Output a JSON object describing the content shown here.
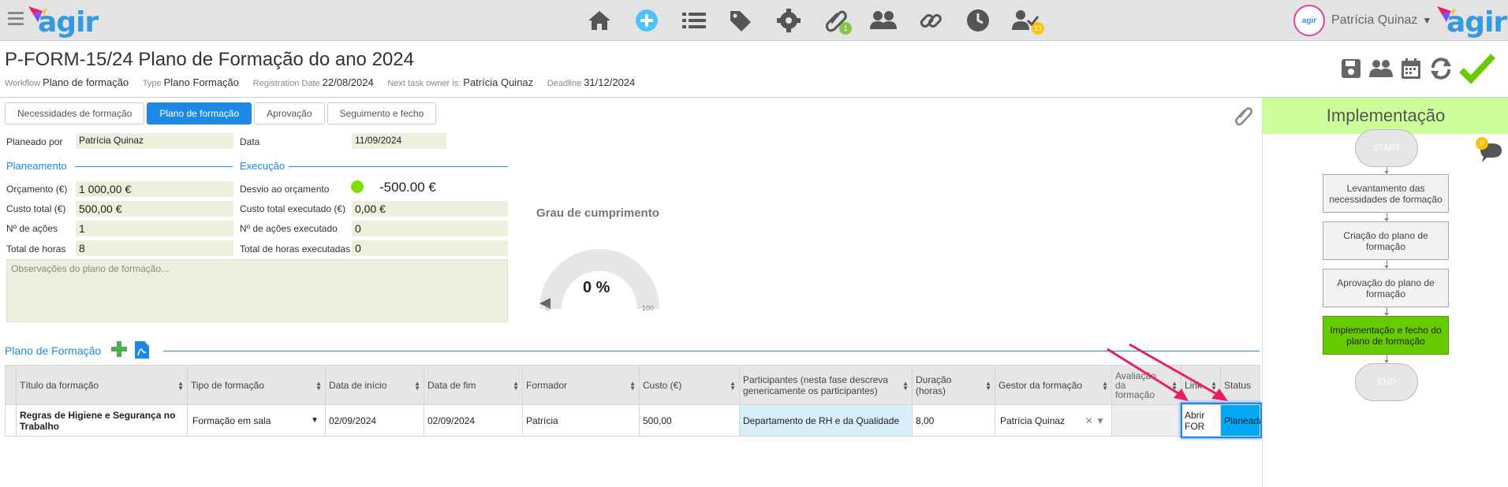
{
  "colors": {
    "accent": "#1e88e5",
    "highlight_bg": "#eeeedd",
    "phase_bg": "#ccff99",
    "active_step": "#66cc00",
    "status_blue": "#03a9f4",
    "arrow": "#e91e63"
  },
  "topbar": {
    "brand": "agir",
    "nav_icons": [
      "home-icon",
      "add-icon",
      "list-icon",
      "tag-icon",
      "gear-icon",
      "attachment-icon",
      "users-icon",
      "link-icon",
      "clock-icon",
      "user-check-icon"
    ],
    "attachment_badge": "1",
    "tasks_badge": "13",
    "user_name": "Patrícia Quinaz"
  },
  "header": {
    "title": "P-FORM-15/24 Plano de Formação do ano 2024",
    "workflow_label": "Workflow",
    "workflow_value": "Plano de formação",
    "type_label": "Type",
    "type_value": "Plano Formação",
    "reg_label": "Registration Date",
    "reg_value": "22/08/2024",
    "owner_label": "Next task owner is:",
    "owner_value": "Patrícia Quinaz",
    "deadline_label": "Deadline",
    "deadline_value": "31/12/2024"
  },
  "tabs": [
    "Necessidades de formação",
    "Plano de formação",
    "Aprovação",
    "Seguimento e fecho"
  ],
  "form": {
    "planeado_label": "Planeado por",
    "planeado_value": "Patrícia Quinaz",
    "data_label": "Data",
    "data_value": "11/09/2024",
    "planeamento": "Planeamento",
    "execucao": "Execução",
    "orcamento_label": "Orçamento (€)",
    "orcamento_value": "1 000,00 €",
    "custo_label": "Custo total (€)",
    "custo_value": "500,00 €",
    "acoes_label": "Nº de ações",
    "acoes_value": "1",
    "horas_label": "Total de horas",
    "horas_value": "8",
    "desvio_label": "Desvio ao orçamento",
    "desvio_value": "-500.00 €",
    "custo_exec_label": "Custo total executado (€)",
    "custo_exec_value": "0,00 €",
    "acoes_exec_label": "Nº de ações executado",
    "acoes_exec_value": "0",
    "horas_exec_label": "Total de horas executadas",
    "horas_exec_value": "0",
    "obs_placeholder": "Observações do plano de formação..."
  },
  "gauge": {
    "title": "Grau de cumprimento",
    "value_text": "0 %",
    "value": 0,
    "min": "0",
    "max": "100"
  },
  "plano": {
    "title": "Plano de Formação",
    "columns": [
      "Título da formação",
      "Tipo de formação",
      "Data de início",
      "Data de fim",
      "Formador",
      "Custo (€)",
      "Participantes (nesta fase descreva genericamente os participantes)",
      "Duração (horas)",
      "Gestor da formação",
      "Avaliação da formação",
      "Link",
      "Status"
    ],
    "row": {
      "titulo": "Regras de Higiene e Segurança no Trabalho",
      "tipo": "Formação em sala",
      "inicio": "02/09/2024",
      "fim": "02/09/2024",
      "formador": "Patrícia",
      "custo": "500,00",
      "participantes": "Departamento de RH e da Qualidade",
      "duracao": "8,00",
      "gestor": "Patrícia Quinaz",
      "avaliacao": "",
      "link": "Abrir FOR",
      "status": "Planeada"
    }
  },
  "right_panel": {
    "phase": "Implementação",
    "comments_count": "0",
    "start": "START",
    "end": "END",
    "steps": [
      "Levantamento das necessidades de formação",
      "Criação do plano de formação",
      "Aprovação do plano de formação",
      "Implementação e fecho do plano de formação"
    ]
  }
}
